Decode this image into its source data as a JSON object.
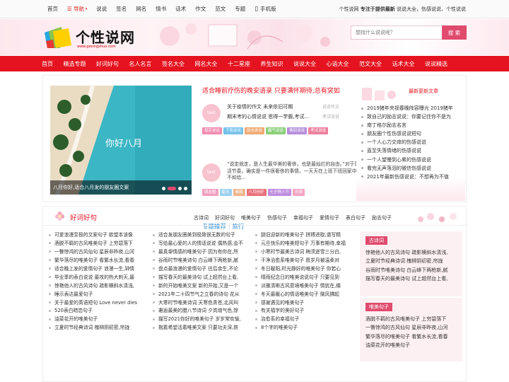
{
  "topbar": {
    "links": [
      "首页",
      "导航",
      "说说",
      "签名",
      "网名",
      "情书",
      "话术",
      "作文",
      "范文",
      "专题",
      "手机版"
    ],
    "right_site": "个性说网",
    "right_bold": "专注于提供最新",
    "right_rest": "说说大全，伤感说说、个性说说"
  },
  "logo": {
    "title": "个性说网",
    "url": "www.gexingshuo.com"
  },
  "search": {
    "placeholder": "想找什么说说呢？",
    "button": "搜 索"
  },
  "nav": [
    "首页",
    "精选专题",
    "好词好句",
    "名人名言",
    "签名大全",
    "网名大全",
    "十二星座",
    "养生知识",
    "说说大全",
    "心语大全",
    "范文大全",
    "话术大全",
    "说说精选"
  ],
  "slider": {
    "caption": "八月你好,适合八月发的朋友圈文案",
    "overlay": "你好八月"
  },
  "featured": {
    "headline": "适合睡前疗伤的晚安语录 只要满怀期待,总有突如",
    "item1": {
      "line1": "关于疫情的作文 未来依旧可期",
      "tag1": "说说作文",
      "line2": "期末考的心情说说 思得一学霸,考试...",
      "tag2": "考试说说"
    },
    "tags": [
      "现实说说",
      "下雨说说",
      "励志说说",
      "霸气说说",
      "情侣说说",
      "考试说说"
    ],
    "tag_colors": [
      "#f08cb0",
      "#76c3ea",
      "#f0a972",
      "#8bcf7a",
      "#b58edb",
      "#ee7f9e"
    ],
    "sub_title": "专题推荐",
    "sub_sep": "｜",
    "sub_title2": "旅行",
    "quote": "“说走就走，是人生最华美的奢侈，也是最灿烂的自由。”对于现在的生活节奏，确实是一件很奢侈的事情，一天天在上班下班回家中度过。不如给...",
    "tags2": [
      "朋友圈",
      "夏天",
      "毒瓶",
      "八月份好",
      "七夕情人节",
      "白夜"
    ],
    "tag2_colors": [
      "#f09ec0",
      "#9bd0f0",
      "#f0b48a",
      "#e9717a",
      "#c08de0",
      "#f4a6c2"
    ]
  },
  "sidebar": {
    "title": "最新更新文章",
    "items": [
      "2019猪年央视春晚阵容曝光 2019猪年",
      "致自己的励志说说：你要记住你不是为",
      "南丁格尔励志名言",
      "朋友圈个性伤感说说短句",
      "一个人心力交瘁的伤感说说",
      "直至失落情绪的伤感说说",
      "一个人望慢到心累的伤感说说",
      "看完无声落泪的微信伤感说说",
      "2021年最新伤感说说：不想再为不值"
    ]
  },
  "section": {
    "title": "好词好句",
    "tabs": [
      "古诗词",
      "好词好句",
      "唯美句子",
      "伤感句子",
      "幸福句子",
      "爱情句子",
      "表白句子",
      "励志句子"
    ],
    "col1": [
      "可爱浪漫至极的文案句子 欲望本该像",
      "酒脱不羁的古风唯美句子 上穷碧落下",
      "一瞥惊鸿的古风仙句 星辰非昨夜,山河",
      "繁华落尽的唯美句子 看繁水长流,看春",
      "适合晚上发的爱情句子 浪漫一生,钟情",
      "毕业季的表白说说 最攻的热大刺天,最",
      "惊艳他人的古风诗句 疏影横斜水清浅,",
      "睡示表达最爱句子",
      "关于最爱的英语短句 Love never dies",
      "520表白暗恋句子",
      "油菜花开的唯美句子",
      "立夏时节经典诗词 槐柳阴初密,帘拢"
    ],
    "col2": [
      "适合发朋友圈美到极致很无数的句子",
      "写给最心爱的人的情话说说 偶热感,会不",
      "最真挚情感的唯美句子 因为有你在,所",
      "谷雨时节唯美诗句 白云峰下两枪新,腻",
      "盘点最浪漫的爱情句子 往后余生,不论",
      "描写春天的最美诗句 试上超然台上看,",
      "新的开始唯美文案 新的开始,又是一个",
      "2021年二十四节气之立春的诗句 花从",
      "大寒时节唯美诗词 天寒色青苍,北风叫",
      "邂逅最美的腊八节诗词 夕岚增气色,馀",
      "描写2021你好的唯美句子 岁岁常欢愉,",
      "抱着希望活着唯美文案 只要功夫深,铁"
    ],
    "col3": [
      "辞旧迎新的唯美句子 拼搏进取,谱写精",
      "元旦快乐的唯美短句子 万事有期待,幸福",
      "小寒时节最美古诗词 梅须迸雪三分白,",
      "干净治愈系唯美句子 愿岁月被温柔对",
      "冬日暖阳,时光静好的唯美句子 你若心",
      "晴雨纪念日的唯美说说句子 只要见到",
      "淡雅清晰古风意境唯美句子 情犹在,蝶",
      "冬天最暖心的情话唯美句子 微风拂起",
      "感谢遇见的唯美句子",
      "有关福字的美好句子",
      "治愈系的幸福句子",
      "8个字的唯美句子"
    ],
    "box1": {
      "title": "古诗词",
      "items": [
        "惊艳他人的古风诗句 疏影横斜水清浅,",
        "立夏时节经典诗词 槐柳阴初密,帘拢",
        "谷雨时节唯美诗句 白云峰下两枪新,腻",
        "描写春天的最美诗句 试上超然台上看,"
      ]
    },
    "box2": {
      "title": "唯美句子",
      "items": [
        "酒脱不羁的古风唯美句子 上穷碧落下",
        "一瞥惊鸿的古风仙句 星辰非昨夜,山河",
        "繁华落尽的唯美句子 看繁水长流,看春",
        "油菜花开的唯美句子"
      ]
    }
  },
  "colors": {
    "accent": "#e5131f",
    "pink": "#e04a6d",
    "link_blue": "#2c8bd6"
  }
}
